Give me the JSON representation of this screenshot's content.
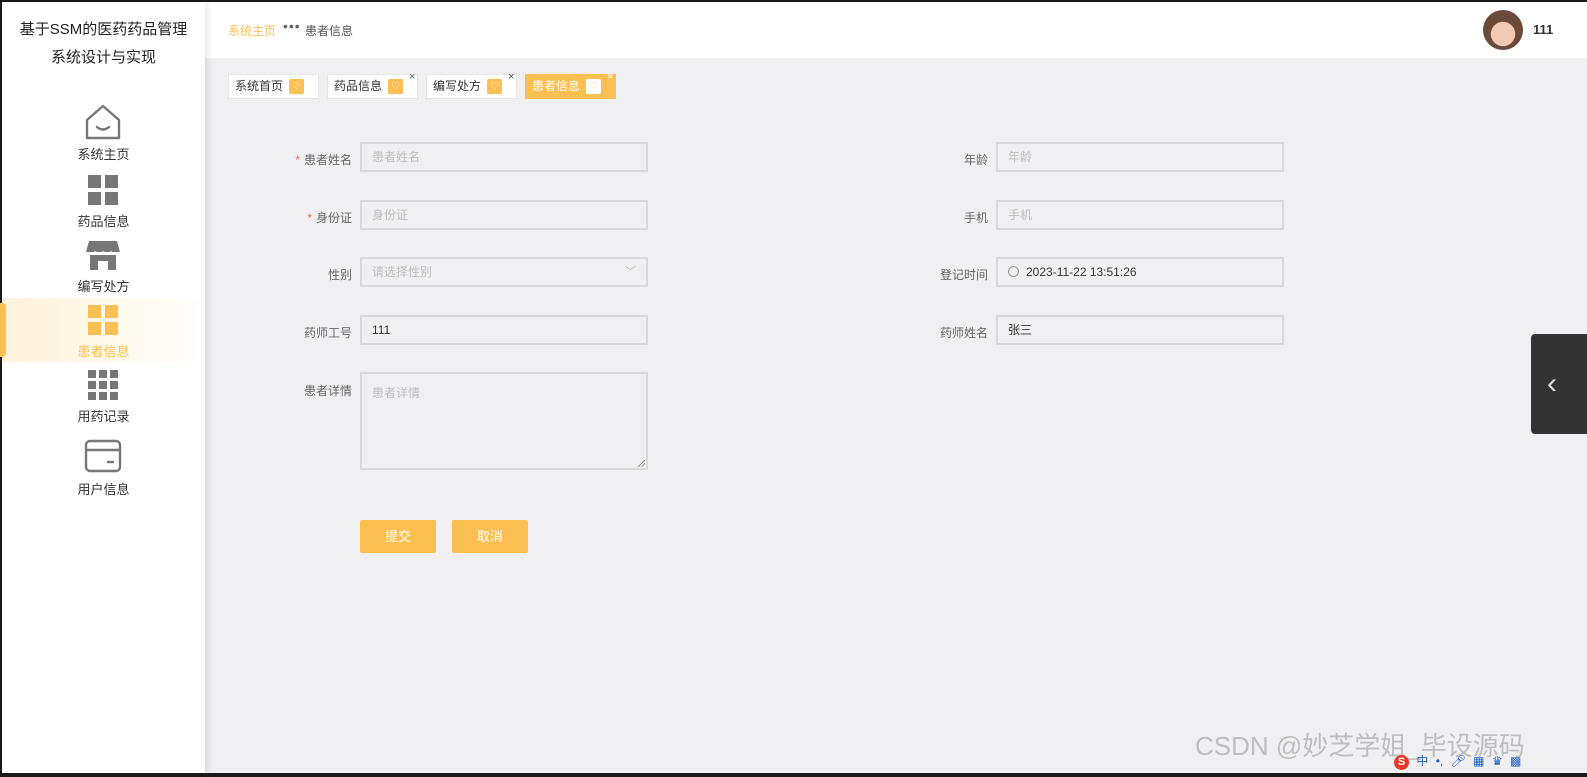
{
  "app": {
    "title_line1": "基于SSM的医药药品管理",
    "title_line2": "系统设计与实现"
  },
  "sidebar": {
    "items": [
      {
        "label": "系统主页",
        "icon": "home-icon"
      },
      {
        "label": "药品信息",
        "icon": "grid-four-icon"
      },
      {
        "label": "编写处方",
        "icon": "shop-icon"
      },
      {
        "label": "患者信息",
        "icon": "grid-four-icon",
        "active": true
      },
      {
        "label": "用药记录",
        "icon": "grid-nine-icon"
      },
      {
        "label": "用户信息",
        "icon": "card-icon"
      }
    ]
  },
  "header": {
    "breadcrumb_home": "系统主页",
    "breadcrumb_current": "患者信息",
    "user_name": "111"
  },
  "tabs": [
    {
      "label": "系统首页",
      "closable": false
    },
    {
      "label": "药品信息",
      "closable": true
    },
    {
      "label": "编写处方",
      "closable": true
    },
    {
      "label": "患者信息",
      "closable": true,
      "active": true
    }
  ],
  "form": {
    "patient_name": {
      "label": "患者姓名",
      "required": true,
      "placeholder": "患者姓名",
      "value": ""
    },
    "age": {
      "label": "年龄",
      "placeholder": "年龄",
      "value": ""
    },
    "id_card": {
      "label": "身份证",
      "required": true,
      "placeholder": "身份证",
      "value": ""
    },
    "phone": {
      "label": "手机",
      "placeholder": "手机",
      "value": ""
    },
    "gender": {
      "label": "性别",
      "placeholder": "请选择性别",
      "value": ""
    },
    "register_time": {
      "label": "登记时间",
      "value": "2023-11-22 13:51:26"
    },
    "pharmacist_id": {
      "label": "药师工号",
      "value": "111"
    },
    "pharmacist_name": {
      "label": "药师姓名",
      "value": "张三"
    },
    "details": {
      "label": "患者详情",
      "placeholder": "患者详情",
      "value": ""
    },
    "submit_label": "提交",
    "cancel_label": "取消"
  },
  "watermark": "CSDN @妙芝学姐_毕设源码",
  "tray": {
    "ime_mode": "中"
  },
  "colors": {
    "accent": "#fbbf52",
    "background": "#f0eff1",
    "required": "#f56c6c"
  }
}
